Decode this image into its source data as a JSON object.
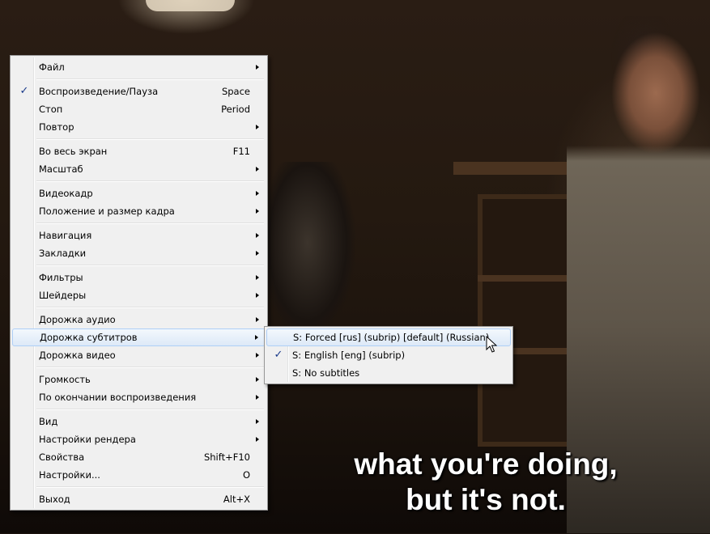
{
  "subtitle": {
    "line1": "what you're doing,",
    "line2": "but it's not."
  },
  "main_menu": {
    "file": "Файл",
    "play_pause": "Воспроизведение/Пауза",
    "play_pause_shortcut": "Space",
    "stop": "Стоп",
    "stop_shortcut": "Period",
    "repeat": "Повтор",
    "fullscreen": "Во весь экран",
    "fullscreen_shortcut": "F11",
    "zoom": "Масштаб",
    "video_frame": "Видеокадр",
    "frame_position_size": "Положение и размер кадра",
    "navigation": "Навигация",
    "bookmarks": "Закладки",
    "filters": "Фильтры",
    "shaders": "Шейдеры",
    "audio_track": "Дорожка аудио",
    "subtitle_track": "Дорожка субтитров",
    "video_track": "Дорожка видео",
    "volume": "Громкость",
    "after_playback": "По окончании воспроизведения",
    "view": "Вид",
    "render_settings": "Настройки рендера",
    "properties": "Свойства",
    "properties_shortcut": "Shift+F10",
    "settings": "Настройки...",
    "settings_shortcut": "O",
    "exit": "Выход",
    "exit_shortcut": "Alt+X"
  },
  "subtitle_menu": {
    "items": [
      {
        "label": "S: Forced [rus] (subrip) [default] (Russian)",
        "checked": false,
        "highlighted": true
      },
      {
        "label": "S: English [eng] (subrip)",
        "checked": true,
        "highlighted": false
      },
      {
        "label": "S: No subtitles",
        "checked": false,
        "highlighted": false
      }
    ]
  },
  "icons": {
    "check": "check-icon",
    "submenu": "submenu-arrow-icon",
    "cursor": "mouse-cursor-icon"
  },
  "colors": {
    "menu_bg": "#f0f0f0",
    "highlight_border": "#aecff7",
    "check_color": "#1a3a8a",
    "subtitle_text": "#ffffff"
  }
}
